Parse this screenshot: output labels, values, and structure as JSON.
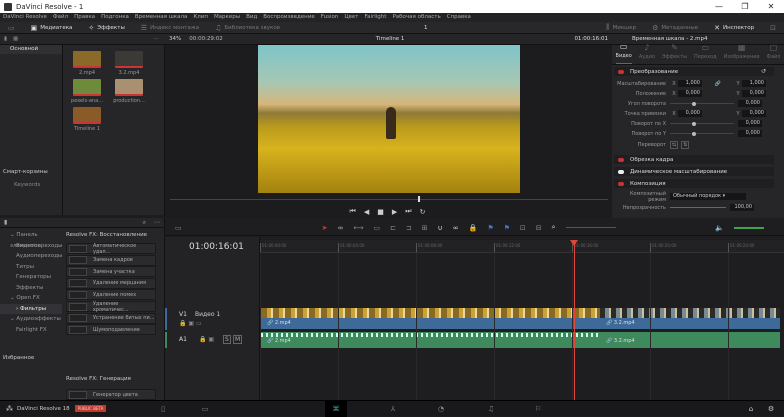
{
  "window": {
    "title": "DaVinci Resolve - 1",
    "minimize": "—",
    "maximize": "❐",
    "close": "✕"
  },
  "menu": [
    "DaVinci Resolve",
    "Файл",
    "Правка",
    "Подгонка",
    "Временная шкала",
    "Клип",
    "Маркеры",
    "Вид",
    "Воспроизведение",
    "Fusion",
    "Цвет",
    "Fairlight",
    "Рабочая область",
    "Справка"
  ],
  "toolbar": {
    "media": "Медиатека",
    "effects": "Эффекты",
    "edit_index": "Индекс монтажа",
    "sound_library": "Библиотека звуков",
    "page_num": "1",
    "mixer": "Микшер",
    "metadata": "Метаданные",
    "inspector": "Инспектор"
  },
  "viewer": {
    "zoom": "34%",
    "duration": "00:00:29:02",
    "timeline_name": "Timeline 1",
    "timecode": "01:00:16:01"
  },
  "media_pool": {
    "bin": "Основной",
    "smart_bins": "Смарт-корзины",
    "keywords": "Keywords",
    "clips": [
      {
        "name": "2.mp4",
        "color": "#8a6a28"
      },
      {
        "name": "3.2.mp4",
        "color": "#3b3a36"
      },
      {
        "name": "pexels-ana...",
        "color": "#6f8a3a"
      },
      {
        "name": "production...",
        "color": "#a89070"
      },
      {
        "name": "Timeline 1",
        "color": "#8a5a28"
      }
    ]
  },
  "inspector": {
    "title": "Временная шкала - 2.mp4",
    "tabs": [
      "Видео",
      "Аудио",
      "Эффекты",
      "Переход",
      "Изображение",
      "Файл"
    ],
    "transform": "Преобразование",
    "zoom_label": "Масштабирование",
    "zoom_x": "1,000",
    "zoom_y": "1,000",
    "position_label": "Положение",
    "pos_x": "0,000",
    "pos_y": "0,000",
    "rotation_label": "Угол поворота",
    "rotation": "0,000",
    "anchor_label": "Точка привязки",
    "anchor_x": "0,000",
    "anchor_y": "0,000",
    "pitch_label": "Поворот по X",
    "pitch": "0,000",
    "yaw_label": "Поворот по Y",
    "yaw": "0,000",
    "flip_label": "Переворот",
    "crop": "Обрезка кадра",
    "dynamic_zoom": "Динамическое масштабирование",
    "composite": "Композиция",
    "composite_mode_label": "Композитный режим",
    "composite_mode": "Обычный порядок",
    "opacity_label": "Непрозрачность",
    "opacity": "100,00"
  },
  "effects": {
    "tree": [
      {
        "label": "Панель элементов",
        "lvl": 0
      },
      {
        "label": "Видеопереходы",
        "lvl": 1
      },
      {
        "label": "Аудиопереходы",
        "lvl": 1
      },
      {
        "label": "Титры",
        "lvl": 1
      },
      {
        "label": "Генераторы",
        "lvl": 1
      },
      {
        "label": "Эффекты",
        "lvl": 1
      },
      {
        "label": "Open FX",
        "lvl": 0
      },
      {
        "label": "Фильтры",
        "lvl": 1,
        "selected": true
      },
      {
        "label": "Аудиоэффекты",
        "lvl": 0
      },
      {
        "label": "Fairlight FX",
        "lvl": 1
      }
    ],
    "favorites": "Избранное",
    "group1": "Resolve FX: Восстановление",
    "items1": [
      "Автоматическое удал...",
      "Замена кадров",
      "Замена участка",
      "Удаление мерцания",
      "Удаление помех",
      "Удаление хроматичес...",
      "Устранение битых пи...",
      "Шумоподавление"
    ],
    "group2": "Resolve FX: Генерация",
    "items2": [
      "Генератор цвета"
    ]
  },
  "timeline": {
    "timecode": "01:00:16:01",
    "ruler": [
      "01:00:00:00",
      "01:00:04:00",
      "01:00:08:00",
      "01:00:12:00",
      "01:00:16:00",
      "01:00:20:00",
      "01:00:24:00"
    ],
    "v1": {
      "id": "V1",
      "name": "Видео 1"
    },
    "a1": {
      "id": "A1",
      "solo": "S",
      "mute": "M"
    },
    "clips_video": [
      "2.mp4",
      "3.2.mp4"
    ],
    "clips_audio": [
      "2.mp4",
      "3.2.mp4"
    ],
    "playhead_color": "#e0453a",
    "video_clip_color": "#3e6a99",
    "audio_clip_color": "#3f8a5c"
  },
  "bottom": {
    "app": "DaVinci Resolve 18",
    "badge": "PUBLIC BETA"
  }
}
